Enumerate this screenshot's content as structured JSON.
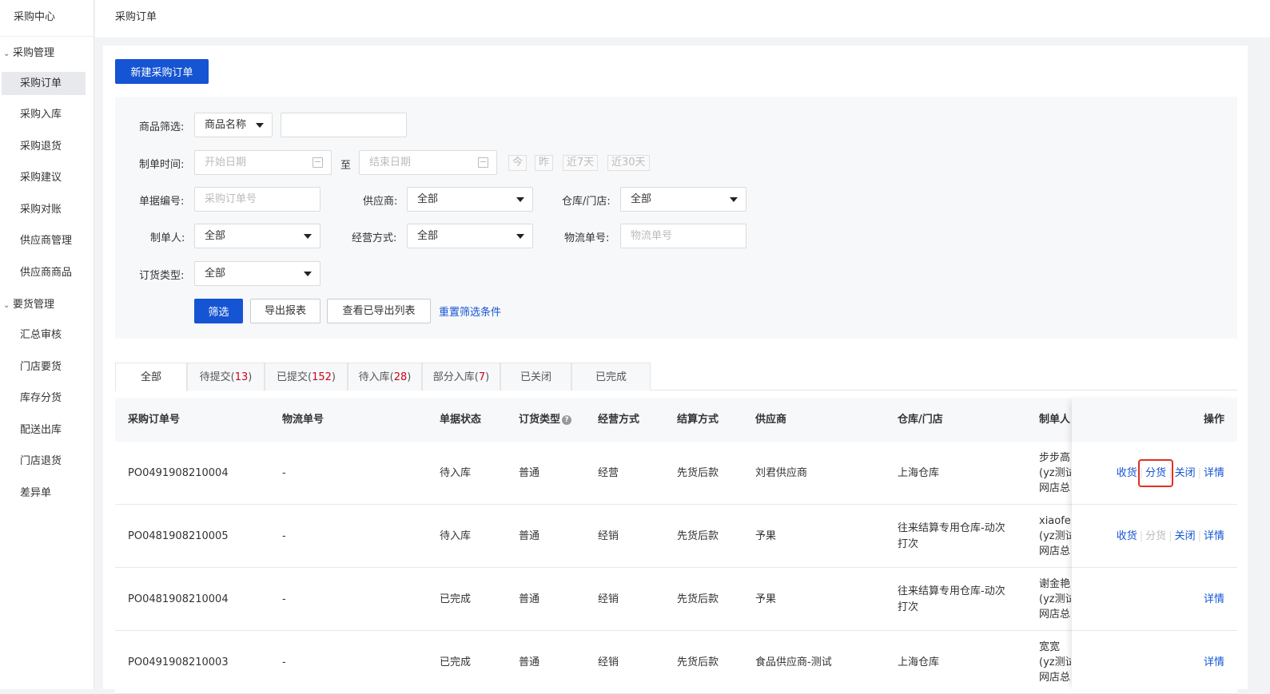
{
  "sidebar": {
    "brand": "采购中心",
    "groups": [
      {
        "label": "采购管理",
        "items": [
          "采购订单",
          "采购入库",
          "采购退货",
          "采购建议",
          "采购对账",
          "供应商管理",
          "供应商商品"
        ]
      },
      {
        "label": "要货管理",
        "items": [
          "汇总审核",
          "门店要货",
          "库存分货",
          "配送出库",
          "门店退货",
          "差异单"
        ]
      }
    ],
    "active": "采购订单"
  },
  "breadcrumb": "采购订单",
  "new_button": "新建采购订单",
  "filter": {
    "product_label": "商品筛选:",
    "product_select": "商品名称",
    "product_input": "",
    "date_label": "制单时间:",
    "start_placeholder": "开始日期",
    "to": "至",
    "end_placeholder": "结束日期",
    "quick": [
      "今",
      "昨",
      "近7天",
      "近30天"
    ],
    "order_no_label": "单据编号:",
    "order_no_placeholder": "采购订单号",
    "supplier_label": "供应商:",
    "supplier_value": "全部",
    "warehouse_label": "仓库/门店:",
    "warehouse_value": "全部",
    "maker_label": "制单人:",
    "maker_value": "全部",
    "mode_label": "经营方式:",
    "mode_value": "全部",
    "logistics_label": "物流单号:",
    "logistics_placeholder": "物流单号",
    "type_label": "订货类型:",
    "type_value": "全部",
    "btn_filter": "筛选",
    "btn_export": "导出报表",
    "btn_view_exported": "查看已导出列表",
    "reset": "重置筛选条件"
  },
  "tabs": [
    {
      "label": "全部",
      "count": ""
    },
    {
      "label": "待提交",
      "count": "13"
    },
    {
      "label": "已提交",
      "count": "152"
    },
    {
      "label": "待入库",
      "count": "28"
    },
    {
      "label": "部分入库",
      "count": "7"
    },
    {
      "label": "已关闭",
      "count": ""
    },
    {
      "label": "已完成",
      "count": ""
    }
  ],
  "columns": [
    "采购订单号",
    "物流单号",
    "单据状态",
    "订货类型",
    "经营方式",
    "结算方式",
    "供应商",
    "仓库/门店",
    "制单人",
    "操作"
  ],
  "rows": [
    {
      "order": "PO0491908210004",
      "logistics": "-",
      "status": "待入库",
      "type": "普通",
      "mode": "经营",
      "settle": "先货后款",
      "supplier": "刘君供应商",
      "warehouse": "上海仓库",
      "warehouse2": "",
      "maker1": "步步高",
      "maker2": "(yz测试",
      "maker3": "网店总",
      "ops": [
        "收货",
        "分货",
        "关闭",
        "详情"
      ]
    },
    {
      "order": "PO0481908210005",
      "logistics": "-",
      "status": "待入库",
      "type": "普通",
      "mode": "经销",
      "settle": "先货后款",
      "supplier": "予果",
      "warehouse": "往来结算专用仓库-动次",
      "warehouse2": "打次",
      "maker1": "xiaofei",
      "maker2": "(yz测试",
      "maker3": "网店总",
      "ops": [
        "收货",
        "分货",
        "关闭",
        "详情"
      ]
    },
    {
      "order": "PO0481908210004",
      "logistics": "-",
      "status": "已完成",
      "type": "普通",
      "mode": "经销",
      "settle": "先货后款",
      "supplier": "予果",
      "warehouse": "往来结算专用仓库-动次",
      "warehouse2": "打次",
      "maker1": "谢金艳",
      "maker2": "(yz测试",
      "maker3": "网店总",
      "ops": [
        "详情"
      ]
    },
    {
      "order": "PO0491908210003",
      "logistics": "-",
      "status": "已完成",
      "type": "普通",
      "mode": "经销",
      "settle": "先货后款",
      "supplier": "食品供应商-测试",
      "warehouse": "上海仓库",
      "warehouse2": "",
      "maker1": "宽宽",
      "maker2": "(yz测试",
      "maker3": "网店总",
      "ops": [
        "详情"
      ]
    }
  ]
}
